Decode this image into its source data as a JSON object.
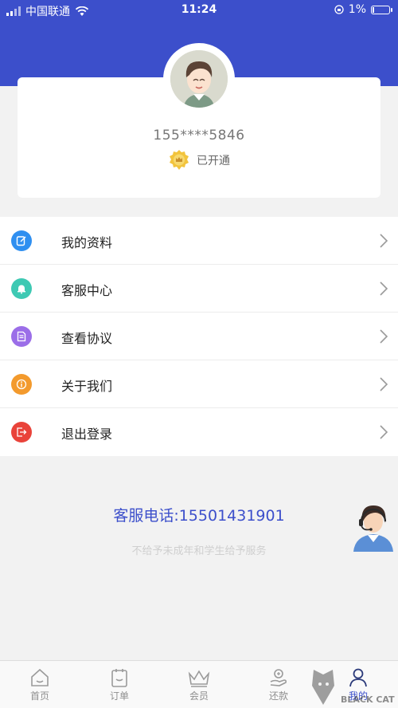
{
  "status_bar": {
    "carrier": "中国联通",
    "time": "11:24",
    "battery": "1%"
  },
  "profile": {
    "phone": "155****5846",
    "member_status": "已开通"
  },
  "menu": [
    {
      "label": "我的资料",
      "icon": "profile-edit-icon",
      "color": "#2f8ff0"
    },
    {
      "label": "客服中心",
      "icon": "bell-icon",
      "color": "#3ec9b3"
    },
    {
      "label": "查看协议",
      "icon": "document-icon",
      "color": "#9b6ee8"
    },
    {
      "label": "关于我们",
      "icon": "info-icon",
      "color": "#f39a2d"
    },
    {
      "label": "退出登录",
      "icon": "logout-icon",
      "color": "#e9433a"
    }
  ],
  "hotline": "客服电话:15501431901",
  "notice": "不给予未成年和学生给予服务",
  "tabs": [
    {
      "label": "首页",
      "icon": "home-icon"
    },
    {
      "label": "订单",
      "icon": "order-icon"
    },
    {
      "label": "会员",
      "icon": "crown-icon"
    },
    {
      "label": "还款",
      "icon": "repay-icon"
    },
    {
      "label": "我的",
      "icon": "user-icon",
      "active": true
    }
  ],
  "watermark": "BLACK CAT",
  "colors": {
    "primary": "#3c4fcb",
    "background": "#f2f2f2"
  }
}
